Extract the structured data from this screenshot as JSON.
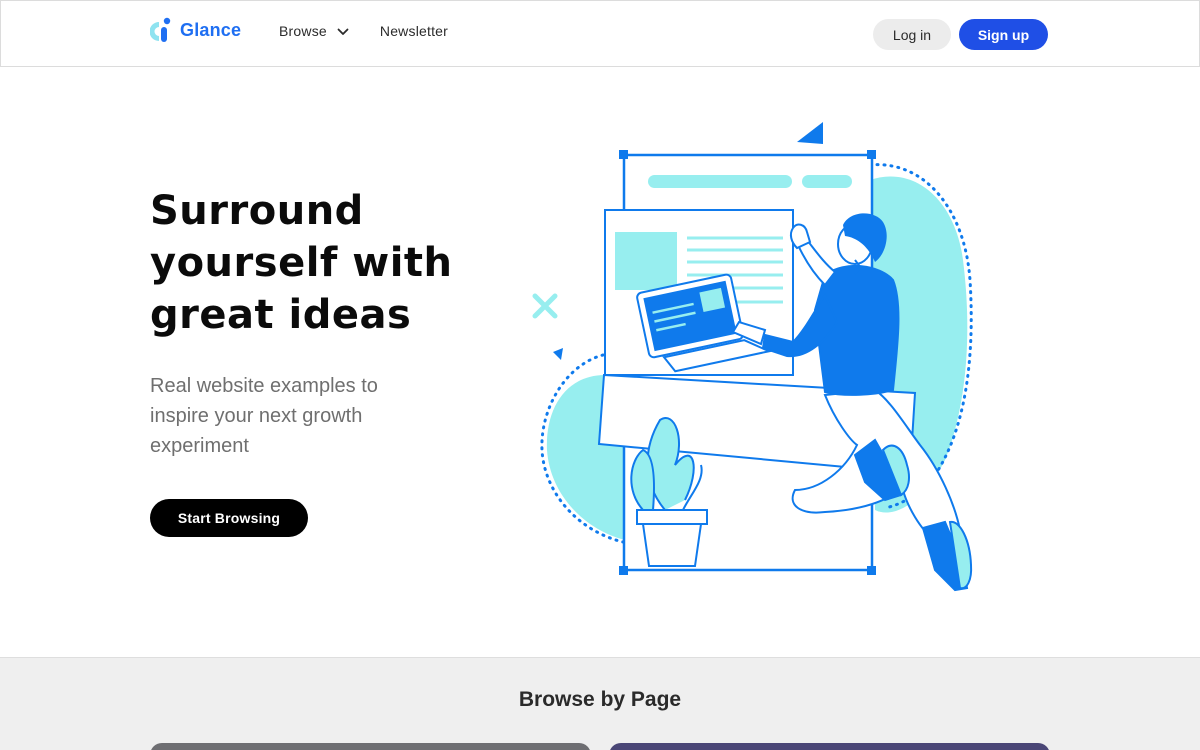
{
  "header": {
    "logo_text": "Glance",
    "nav": {
      "browse_label": "Browse",
      "newsletter_label": "Newsletter"
    },
    "login_label": "Log in",
    "signup_label": "Sign up"
  },
  "hero": {
    "title_lines": [
      "Surround",
      "yourself with",
      "great ideas"
    ],
    "subtitle": "Real website examples to inspire your next growth experiment",
    "cta_label": "Start Browsing"
  },
  "browse_section": {
    "title": "Browse by Page"
  },
  "colors": {
    "brand_blue": "#1f6ff2",
    "signup_blue": "#1f4fe6",
    "illustration_blue": "#0f7aec",
    "illustration_cyan": "#97eeef",
    "card_left": "#6e6e72",
    "card_right": "#4a4676"
  },
  "icons": {
    "logo": "glance-logo-icon",
    "dropdown": "chevron-down-icon"
  }
}
